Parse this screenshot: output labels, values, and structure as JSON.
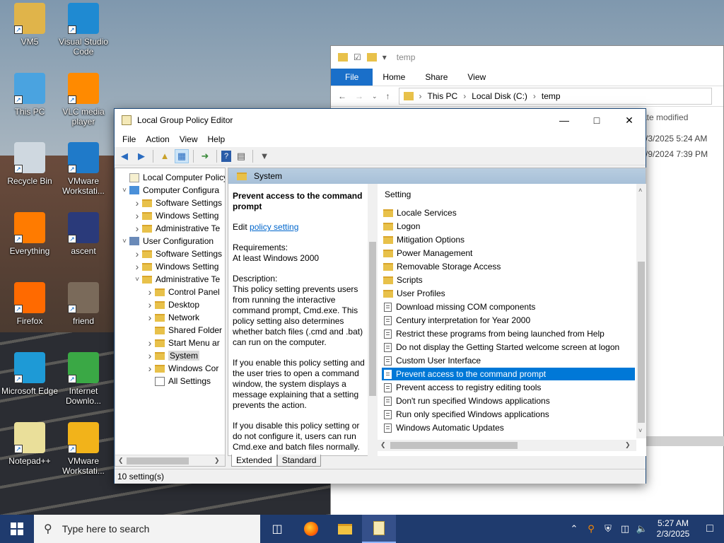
{
  "desktop_icons": [
    {
      "label": "VM5",
      "icon": "user-folder-icon"
    },
    {
      "label": "Visual Studio Code",
      "icon": "vscode-icon"
    },
    {
      "label": "This PC",
      "icon": "computer-icon"
    },
    {
      "label": "VLC media player",
      "icon": "vlc-icon"
    },
    {
      "label": "Recycle Bin",
      "icon": "recycle-bin-icon"
    },
    {
      "label": "VMware Workstati...",
      "icon": "vmware-icon"
    },
    {
      "label": "Everything",
      "icon": "everything-search-icon"
    },
    {
      "label": "ascent",
      "icon": "ascent-image-icon"
    },
    {
      "label": "Firefox",
      "icon": "firefox-icon"
    },
    {
      "label": "friend",
      "icon": "friend-image-icon"
    },
    {
      "label": "Microsoft Edge",
      "icon": "edge-icon"
    },
    {
      "label": "Internet Downlo...",
      "icon": "idm-icon"
    },
    {
      "label": "Notepad++",
      "icon": "notepadpp-icon"
    },
    {
      "label": "VMware Workstati...",
      "icon": "vmware-pro-icon"
    }
  ],
  "explorer": {
    "title": "temp",
    "ribbon": [
      "File",
      "Home",
      "Share",
      "View"
    ],
    "path": [
      "This PC",
      "Local Disk (C:)",
      "temp"
    ],
    "column": "ate modified",
    "rows": [
      "/3/2025 5:24 AM",
      "/9/2024 7:39 PM"
    ]
  },
  "gpo": {
    "title": "Local Group Policy Editor",
    "menu": [
      "File",
      "Action",
      "View",
      "Help"
    ],
    "tree": [
      {
        "label": "Local Computer Policy",
        "level": 0,
        "arrow": "",
        "type": "policy"
      },
      {
        "label": "Computer Configura",
        "level": 0,
        "arrow": "v",
        "type": "computer"
      },
      {
        "label": "Software Settings",
        "level": 1,
        "arrow": ">",
        "type": "folder"
      },
      {
        "label": "Windows Setting",
        "level": 1,
        "arrow": ">",
        "type": "folder"
      },
      {
        "label": "Administrative Te",
        "level": 1,
        "arrow": ">",
        "type": "folder"
      },
      {
        "label": "User Configuration",
        "level": 0,
        "arrow": "v",
        "type": "user"
      },
      {
        "label": "Software Settings",
        "level": 1,
        "arrow": ">",
        "type": "folder"
      },
      {
        "label": "Windows Setting",
        "level": 1,
        "arrow": ">",
        "type": "folder"
      },
      {
        "label": "Administrative Te",
        "level": 1,
        "arrow": "v",
        "type": "folder"
      },
      {
        "label": "Control Panel",
        "level": 2,
        "arrow": ">",
        "type": "folder"
      },
      {
        "label": "Desktop",
        "level": 2,
        "arrow": ">",
        "type": "folder"
      },
      {
        "label": "Network",
        "level": 2,
        "arrow": ">",
        "type": "folder"
      },
      {
        "label": "Shared Folder",
        "level": 2,
        "arrow": "",
        "type": "folder"
      },
      {
        "label": "Start Menu ar",
        "level": 2,
        "arrow": ">",
        "type": "folder"
      },
      {
        "label": "System",
        "level": 2,
        "arrow": ">",
        "type": "folder",
        "selected": true
      },
      {
        "label": "Windows Cor",
        "level": 2,
        "arrow": ">",
        "type": "folder"
      },
      {
        "label": "All Settings",
        "level": 2,
        "arrow": "",
        "type": "settings"
      }
    ],
    "header": "System",
    "description": {
      "title": "Prevent access to the command prompt",
      "edit_prefix": "Edit ",
      "edit_link": "policy setting",
      "req_label": "Requirements:",
      "req_value": "At least Windows 2000",
      "desc_label": "Description:",
      "desc_text": "This policy setting prevents users from running the interactive command prompt, Cmd.exe.  This policy setting also determines whether batch files (.cmd and .bat) can run on the computer.",
      "enable_text": "If you enable this policy setting and the user tries to open a command window, the system displays a message explaining that a setting prevents the action.",
      "disable_text": "If you disable this policy setting or do not configure it, users can run Cmd.exe and batch files normally."
    },
    "list_header": "Setting",
    "settings": [
      {
        "label": "Locale Services",
        "type": "folder"
      },
      {
        "label": "Logon",
        "type": "folder"
      },
      {
        "label": "Mitigation Options",
        "type": "folder"
      },
      {
        "label": "Power Management",
        "type": "folder"
      },
      {
        "label": "Removable Storage Access",
        "type": "folder"
      },
      {
        "label": "Scripts",
        "type": "folder"
      },
      {
        "label": "User Profiles",
        "type": "folder"
      },
      {
        "label": "Download missing COM components",
        "type": "policy"
      },
      {
        "label": "Century interpretation for Year 2000",
        "type": "policy"
      },
      {
        "label": "Restrict these programs from being launched from Help",
        "type": "policy"
      },
      {
        "label": "Do not display the Getting Started welcome screen at logon",
        "type": "policy"
      },
      {
        "label": "Custom User Interface",
        "type": "policy"
      },
      {
        "label": "Prevent access to the command prompt",
        "type": "policy",
        "selected": true
      },
      {
        "label": "Prevent access to registry editing tools",
        "type": "policy"
      },
      {
        "label": "Don't run specified Windows applications",
        "type": "policy"
      },
      {
        "label": "Run only specified Windows applications",
        "type": "policy"
      },
      {
        "label": "Windows Automatic Updates",
        "type": "policy"
      }
    ],
    "tabs": [
      "Extended",
      "Standard"
    ],
    "status": "10 setting(s)"
  },
  "taskbar": {
    "search_placeholder": "Type here to search",
    "time": "5:27 AM",
    "date": "2/3/2025"
  },
  "colors": {
    "accent": "#0078d7",
    "taskbar": "#1f3b6e"
  }
}
